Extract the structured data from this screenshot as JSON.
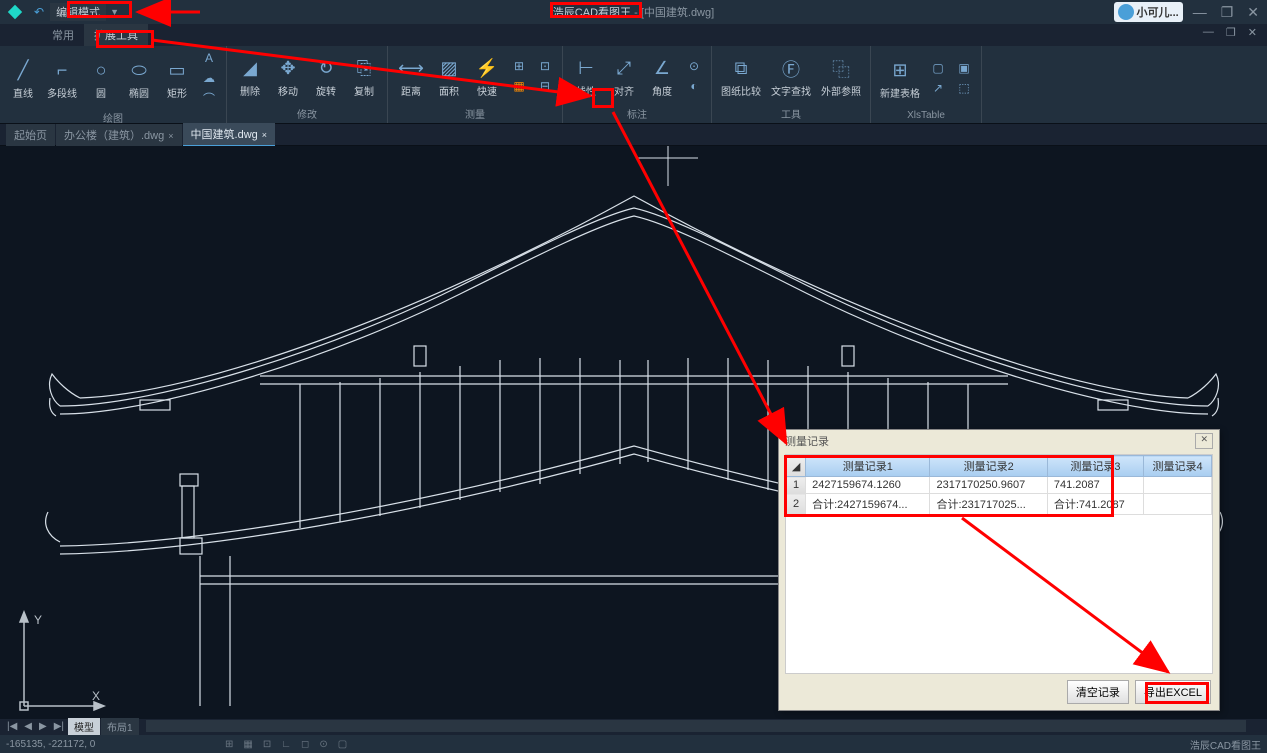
{
  "titlebar": {
    "edit_mode": "编辑模式",
    "app_name": "浩辰CAD看图王",
    "file_name": "中国建筑.dwg",
    "user_name": "小可儿..."
  },
  "menu": {
    "changyong": "常用",
    "kuozhan": "扩展工具"
  },
  "ribbon": {
    "groups": {
      "draw": {
        "label": "绘图",
        "items": [
          "直线",
          "多段线",
          "圆",
          "椭圆",
          "矩形"
        ]
      },
      "modify": {
        "label": "修改",
        "items": [
          "删除",
          "移动",
          "旋转",
          "复制"
        ]
      },
      "measure": {
        "label": "测量",
        "items": [
          "距离",
          "面积",
          "快速"
        ]
      },
      "annotate": {
        "label": "标注",
        "items": [
          "线性",
          "对齐",
          "角度"
        ]
      },
      "tools": {
        "label": "工具",
        "items": [
          "图纸比较",
          "文字查找",
          "外部参照"
        ]
      },
      "xlstable": {
        "label": "XlsTable",
        "items": [
          "新建表格"
        ]
      }
    },
    "text_tool": "A"
  },
  "doctabs": {
    "tab1": "起始页",
    "tab2": "办公楼（建筑）.dwg",
    "tab3": "中国建筑.dwg"
  },
  "layout": {
    "model": "模型",
    "layout1": "布局1"
  },
  "statusbar": {
    "coords": "-165135, -221172, 0",
    "brand": "浩辰CAD看图王"
  },
  "popup": {
    "title": "测量记录",
    "headers": [
      "测量记录1",
      "测量记录2",
      "测量记录3",
      "测量记录4"
    ],
    "rows": [
      {
        "num": "1",
        "c1": "2427159674.1260",
        "c2": "2317170250.9607",
        "c3": "741.2087",
        "c4": ""
      },
      {
        "num": "2",
        "c1": "合计:2427159674...",
        "c2": "合计:231717025...",
        "c3": "合计:741.2087",
        "c4": ""
      }
    ],
    "btn_clear": "清空记录",
    "btn_export": "导出EXCEL"
  }
}
